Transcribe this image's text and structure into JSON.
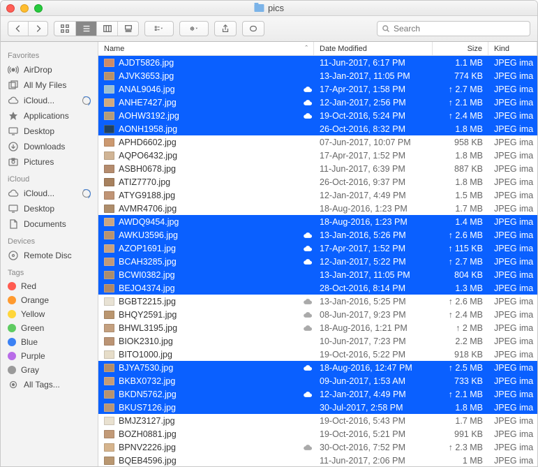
{
  "window": {
    "title": "pics"
  },
  "toolbar": {
    "search_placeholder": "Search"
  },
  "sidebar": {
    "sections": [
      {
        "label": "Favorites",
        "items": [
          {
            "label": "AirDrop",
            "icon": "airdrop"
          },
          {
            "label": "All My Files",
            "icon": "allfiles"
          },
          {
            "label": "iCloud...",
            "icon": "cloud",
            "progress": true
          },
          {
            "label": "Applications",
            "icon": "apps"
          },
          {
            "label": "Desktop",
            "icon": "desktop"
          },
          {
            "label": "Downloads",
            "icon": "downloads"
          },
          {
            "label": "Pictures",
            "icon": "pictures"
          }
        ]
      },
      {
        "label": "iCloud",
        "items": [
          {
            "label": "iCloud...",
            "icon": "cloud",
            "progress": true
          },
          {
            "label": "Desktop",
            "icon": "desktop"
          },
          {
            "label": "Documents",
            "icon": "documents"
          }
        ]
      },
      {
        "label": "Devices",
        "items": [
          {
            "label": "Remote Disc",
            "icon": "remotedisc"
          }
        ]
      },
      {
        "label": "Tags",
        "items": [
          {
            "label": "Red",
            "tag": "#ff5b50"
          },
          {
            "label": "Orange",
            "tag": "#ff9a2f"
          },
          {
            "label": "Yellow",
            "tag": "#ffd63a"
          },
          {
            "label": "Green",
            "tag": "#5ecb61"
          },
          {
            "label": "Blue",
            "tag": "#3b81f4"
          },
          {
            "label": "Purple",
            "tag": "#b86ce8"
          },
          {
            "label": "Gray",
            "tag": "#9a9a9a"
          },
          {
            "label": "All Tags...",
            "icon": "alltags"
          }
        ]
      }
    ]
  },
  "columns": {
    "name": "Name",
    "date": "Date Modified",
    "size": "Size",
    "kind": "Kind"
  },
  "files": [
    {
      "n": "AJDT5826.jpg",
      "d": "11-Jun-2017, 6:17 PM",
      "s": "1.1 MB",
      "k": "JPEG ima",
      "sel": true,
      "c": false,
      "u": false,
      "t": "#cd8b67"
    },
    {
      "n": "AJVK3653.jpg",
      "d": "13-Jan-2017, 11:05 PM",
      "s": "774 KB",
      "k": "JPEG ima",
      "sel": true,
      "c": false,
      "u": false,
      "t": "#b79169"
    },
    {
      "n": "ANAL9046.jpg",
      "d": "17-Apr-2017, 1:58 PM",
      "s": "2.7 MB",
      "k": "JPEG ima",
      "sel": true,
      "c": true,
      "u": true,
      "t": "#9cbfd1"
    },
    {
      "n": "ANHE7427.jpg",
      "d": "12-Jan-2017, 2:56 PM",
      "s": "2.1 MB",
      "k": "JPEG ima",
      "sel": true,
      "c": true,
      "u": true,
      "t": "#cfa97f"
    },
    {
      "n": "AOHW3192.jpg",
      "d": "19-Oct-2016, 5:24 PM",
      "s": "2.4 MB",
      "k": "JPEG ima",
      "sel": true,
      "c": true,
      "u": true,
      "t": "#b49c7a"
    },
    {
      "n": "AONH1958.jpg",
      "d": "26-Oct-2016, 8:32 PM",
      "s": "1.8 MB",
      "k": "JPEG ima",
      "sel": true,
      "c": false,
      "u": false,
      "t": "#214160"
    },
    {
      "n": "APHD6602.jpg",
      "d": "07-Jun-2017, 10:07 PM",
      "s": "958 KB",
      "k": "JPEG ima",
      "sel": false,
      "c": false,
      "u": false,
      "t": "#cc9970"
    },
    {
      "n": "AQPO6432.jpg",
      "d": "17-Apr-2017, 1:52 PM",
      "s": "1.8 MB",
      "k": "JPEG ima",
      "sel": false,
      "c": false,
      "u": false,
      "t": "#d0b495"
    },
    {
      "n": "ASBH0678.jpg",
      "d": "11-Jun-2017, 6:39 PM",
      "s": "887 KB",
      "k": "JPEG ima",
      "sel": false,
      "c": false,
      "u": false,
      "t": "#b58c6e"
    },
    {
      "n": "ATIZ7770.jpg",
      "d": "26-Oct-2016, 9:37 PM",
      "s": "1.8 MB",
      "k": "JPEG ima",
      "sel": false,
      "c": false,
      "u": false,
      "t": "#a7815e"
    },
    {
      "n": "ATYG9188.jpg",
      "d": "12-Jan-2017, 4:49 PM",
      "s": "1.5 MB",
      "k": "JPEG ima",
      "sel": false,
      "c": false,
      "u": false,
      "t": "#c09475"
    },
    {
      "n": "AVMR4706.jpg",
      "d": "18-Aug-2016, 1:23 PM",
      "s": "1.7 MB",
      "k": "JPEG ima",
      "sel": false,
      "c": false,
      "u": false,
      "t": "#ae8d6b"
    },
    {
      "n": "AWDQ9454.jpg",
      "d": "18-Aug-2016, 1:23 PM",
      "s": "1.4 MB",
      "k": "JPEG ima",
      "sel": true,
      "c": false,
      "u": false,
      "t": "#caa582"
    },
    {
      "n": "AWKU3596.jpg",
      "d": "13-Jan-2016, 5:26 PM",
      "s": "2.6 MB",
      "k": "JPEG ima",
      "sel": true,
      "c": true,
      "u": true,
      "t": "#b89370"
    },
    {
      "n": "AZOP1691.jpg",
      "d": "17-Apr-2017, 1:52 PM",
      "s": "115 KB",
      "k": "JPEG ima",
      "sel": true,
      "c": true,
      "u": true,
      "t": "#c7a180"
    },
    {
      "n": "BCAH3285.jpg",
      "d": "12-Jan-2017, 5:22 PM",
      "s": "2.7 MB",
      "k": "JPEG ima",
      "sel": true,
      "c": true,
      "u": true,
      "t": "#c0997a"
    },
    {
      "n": "BCWI0382.jpg",
      "d": "13-Jan-2017, 11:05 PM",
      "s": "804 KB",
      "k": "JPEG ima",
      "sel": true,
      "c": false,
      "u": false,
      "t": "#aa8d6d"
    },
    {
      "n": "BEJO4374.jpg",
      "d": "28-Oct-2016, 8:14 PM",
      "s": "1.3 MB",
      "k": "JPEG ima",
      "sel": true,
      "c": false,
      "u": false,
      "t": "#b08866"
    },
    {
      "n": "BGBT2215.jpg",
      "d": "13-Jan-2016, 5:25 PM",
      "s": "2.6 MB",
      "k": "JPEG ima",
      "sel": false,
      "c": true,
      "u": true,
      "t": "#e8e2d4"
    },
    {
      "n": "BHQY2591.jpg",
      "d": "08-Jun-2017, 9:23 PM",
      "s": "2.4 MB",
      "k": "JPEG ima",
      "sel": false,
      "c": true,
      "u": true,
      "t": "#ba966f"
    },
    {
      "n": "BHWL3195.jpg",
      "d": "18-Aug-2016, 1:21 PM",
      "s": "2 MB",
      "k": "JPEG ima",
      "sel": false,
      "c": true,
      "u": true,
      "t": "#c4a07f"
    },
    {
      "n": "BIOK2310.jpg",
      "d": "10-Jun-2017, 7:23 PM",
      "s": "2.2 MB",
      "k": "JPEG ima",
      "sel": false,
      "c": false,
      "u": false,
      "t": "#bb9474"
    },
    {
      "n": "BITO1000.jpg",
      "d": "19-Oct-2016, 5:22 PM",
      "s": "918 KB",
      "k": "JPEG ima",
      "sel": false,
      "c": false,
      "u": false,
      "t": "#e6ddc9"
    },
    {
      "n": "BJYA7530.jpg",
      "d": "18-Aug-2016, 12:47 PM",
      "s": "2.5 MB",
      "k": "JPEG ima",
      "sel": true,
      "c": true,
      "u": true,
      "t": "#b38d68"
    },
    {
      "n": "BKBX0732.jpg",
      "d": "09-Jun-2017, 1:53 AM",
      "s": "733 KB",
      "k": "JPEG ima",
      "sel": true,
      "c": false,
      "u": false,
      "t": "#c49c78"
    },
    {
      "n": "BKDN5762.jpg",
      "d": "12-Jan-2017, 4:49 PM",
      "s": "2.1 MB",
      "k": "JPEG ima",
      "sel": true,
      "c": true,
      "u": true,
      "t": "#b79370"
    },
    {
      "n": "BKUS7126.jpg",
      "d": "30-Jul-2017, 2:58 PM",
      "s": "1.8 MB",
      "k": "JPEG ima",
      "sel": true,
      "c": false,
      "u": false,
      "t": "#b99676"
    },
    {
      "n": "BMJZ3127.jpg",
      "d": "19-Oct-2016, 5:43 PM",
      "s": "1.7 MB",
      "k": "JPEG ima",
      "sel": false,
      "c": false,
      "u": false,
      "t": "#e9e1d0"
    },
    {
      "n": "BOZH0881.jpg",
      "d": "19-Oct-2016, 5:21 PM",
      "s": "991 KB",
      "k": "JPEG ima",
      "sel": false,
      "c": false,
      "u": false,
      "t": "#c29a77"
    },
    {
      "n": "BPNV2226.jpg",
      "d": "30-Oct-2016, 7:52 PM",
      "s": "2.3 MB",
      "k": "JPEG ima",
      "sel": false,
      "c": true,
      "u": true,
      "t": "#d6b48d"
    },
    {
      "n": "BQEB4596.jpg",
      "d": "11-Jun-2017, 2:06 PM",
      "s": "1 MB",
      "k": "JPEG ima",
      "sel": false,
      "c": false,
      "u": false,
      "t": "#b99771"
    }
  ]
}
